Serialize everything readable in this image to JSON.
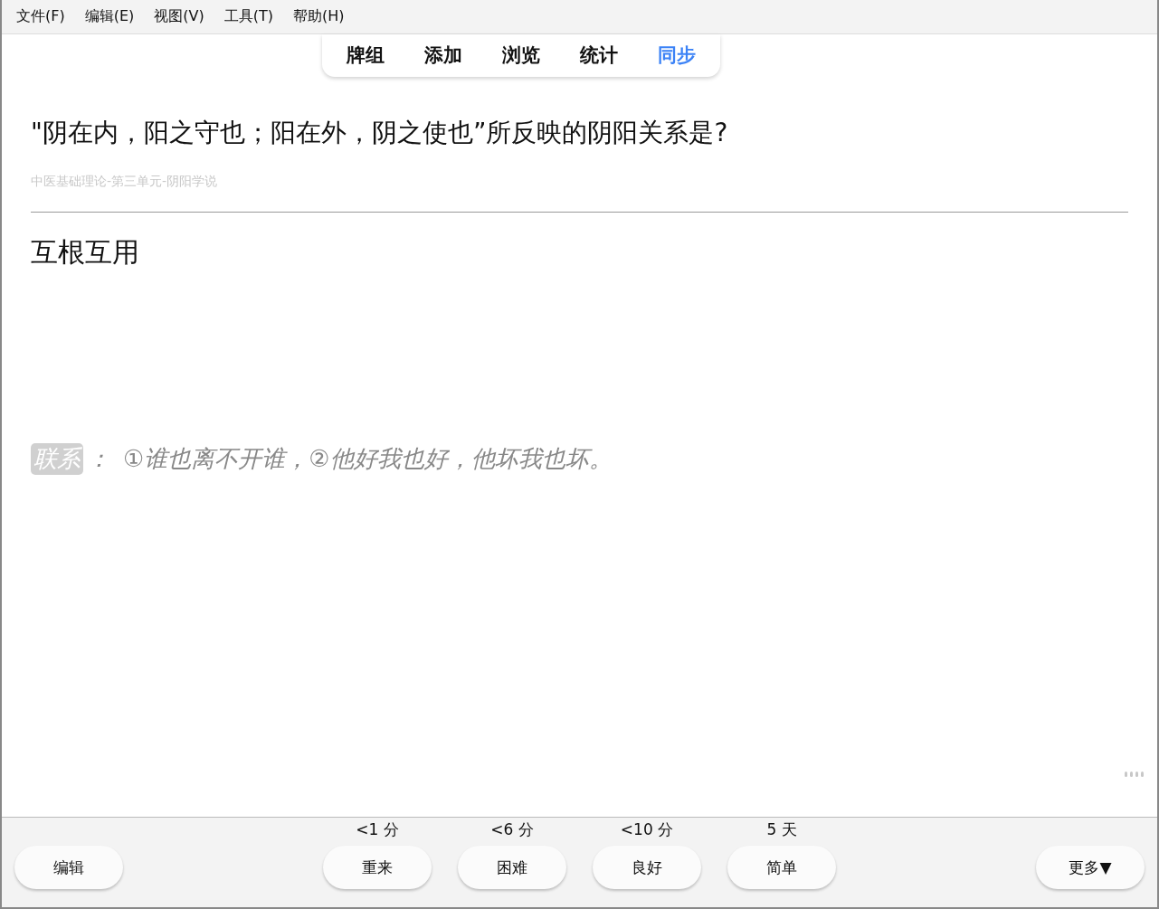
{
  "menu": [
    "文件(F)",
    "编辑(E)",
    "视图(V)",
    "工具(T)",
    "帮助(H)"
  ],
  "tabs": [
    {
      "label": "牌组",
      "selected": false
    },
    {
      "label": "添加",
      "selected": false
    },
    {
      "label": "浏览",
      "selected": false
    },
    {
      "label": "统计",
      "selected": false
    },
    {
      "label": "同步",
      "selected": true
    }
  ],
  "card": {
    "question": "\"阴在内，阳之守也；阳在外，阴之使也”所反映的阴阳关系是?",
    "deck_path": "中医基础理论-第三单元-阴阳学说",
    "answer": "互根互用",
    "note_tag": "联系",
    "note_separator": "：",
    "note_text": "①谁也离不开谁，②他好我也好，他坏我也坏。"
  },
  "bottom": {
    "edit_button": "编辑",
    "answers": [
      {
        "interval": "<1 分",
        "label": "重来"
      },
      {
        "interval": "<6 分",
        "label": "困难"
      },
      {
        "interval": "<10 分",
        "label": "良好"
      },
      {
        "interval": "5 天",
        "label": "简单"
      }
    ],
    "more_button": "更多▼"
  }
}
